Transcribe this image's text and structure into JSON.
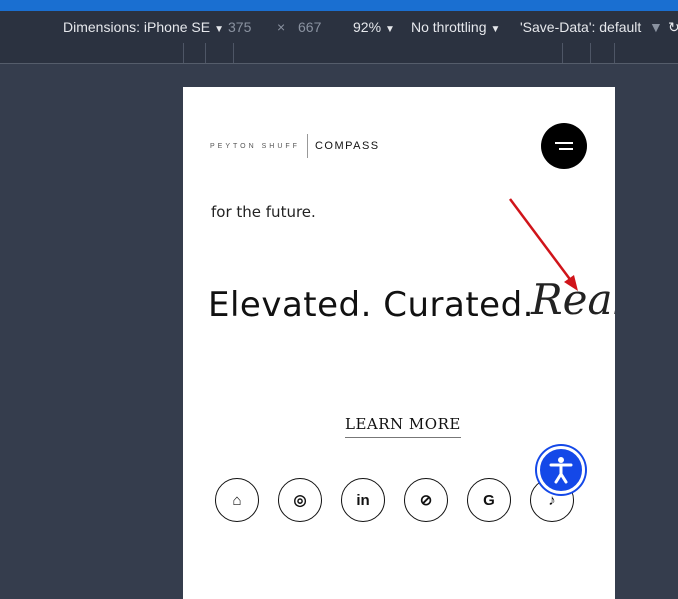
{
  "devtools": {
    "dimensions_label": "Dimensions: iPhone SE",
    "width": "375",
    "times": "×",
    "height": "667",
    "zoom": "92%",
    "throttling": "No throttling",
    "save_data": "'Save-Data': default"
  },
  "site": {
    "logo_name": "PEYTON SHUFF",
    "logo_brand": "COMPASS",
    "intro_text": "for the future.",
    "headline": "Elevated. Curated.",
    "script_word": "Real",
    "cta": "LEARN MORE",
    "socials": [
      {
        "icon": "zillow-icon",
        "glyph": "⌂"
      },
      {
        "icon": "instagram-icon",
        "glyph": "◎"
      },
      {
        "icon": "linkedin-icon",
        "glyph": "in"
      },
      {
        "icon": "compass-icon",
        "glyph": "⊘"
      },
      {
        "icon": "google-icon",
        "glyph": "G"
      },
      {
        "icon": "tiktok-icon",
        "glyph": "♪"
      }
    ]
  },
  "colors": {
    "devtools_bg": "#2b3240",
    "canvas_bg": "#353d4d",
    "accessibility_blue": "#1448e8",
    "arrow_red": "#d0141a"
  }
}
